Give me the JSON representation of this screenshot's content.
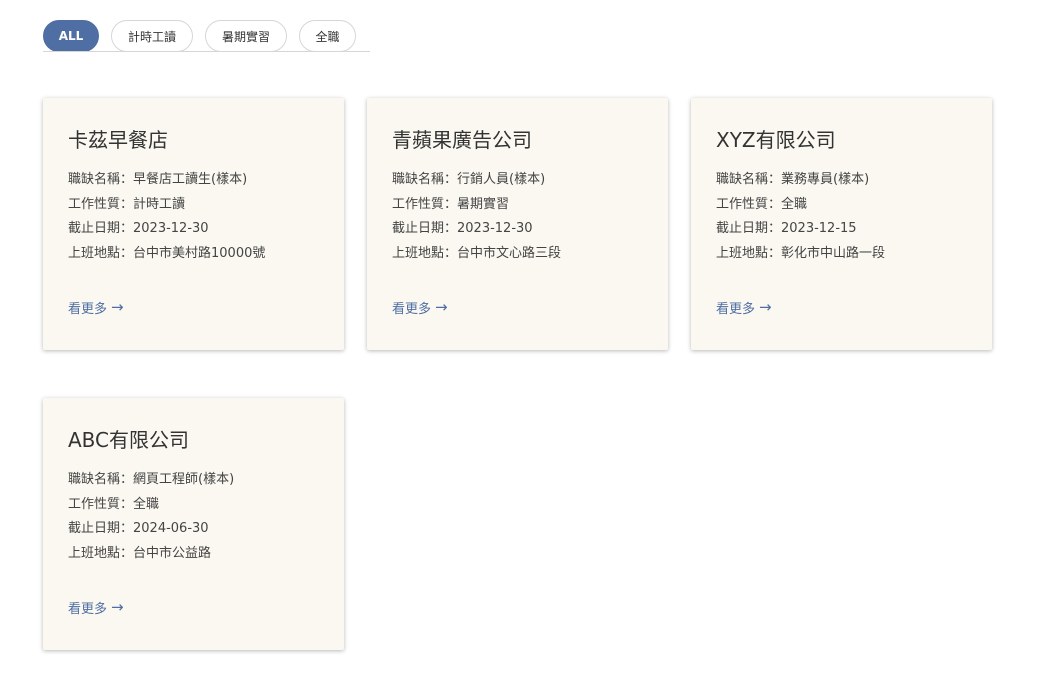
{
  "tabs": [
    {
      "label": "ALL",
      "active": true
    },
    {
      "label": "計時工讀",
      "active": false
    },
    {
      "label": "暑期實習",
      "active": false
    },
    {
      "label": "全職",
      "active": false
    }
  ],
  "field_labels": {
    "position": "職缺名稱：",
    "type": "工作性質：",
    "deadline": "截止日期：",
    "location": "上班地點："
  },
  "cards": [
    {
      "company": "卡茲早餐店",
      "position": "早餐店工讀生(樣本)",
      "type": "計時工讀",
      "deadline": "2023-12-30",
      "location": "台中市美村路10000號",
      "more_label": "看更多"
    },
    {
      "company": "青蘋果廣告公司",
      "position": "行銷人員(樣本)",
      "type": "暑期實習",
      "deadline": "2023-12-30",
      "location": "台中市文心路三段",
      "more_label": "看更多"
    },
    {
      "company": "XYZ有限公司",
      "position": "業務專員(樣本)",
      "type": "全職",
      "deadline": "2023-12-15",
      "location": "彰化市中山路一段",
      "more_label": "看更多"
    },
    {
      "company": "ABC有限公司",
      "position": "網頁工程師(樣本)",
      "type": "全職",
      "deadline": "2024-06-30",
      "location": "台中市公益路",
      "more_label": "看更多"
    }
  ],
  "icons": {
    "more_arrow": "arrow-right-icon"
  },
  "colors": {
    "accent": "#4f6ea3",
    "card_bg": "#faf8f1"
  }
}
